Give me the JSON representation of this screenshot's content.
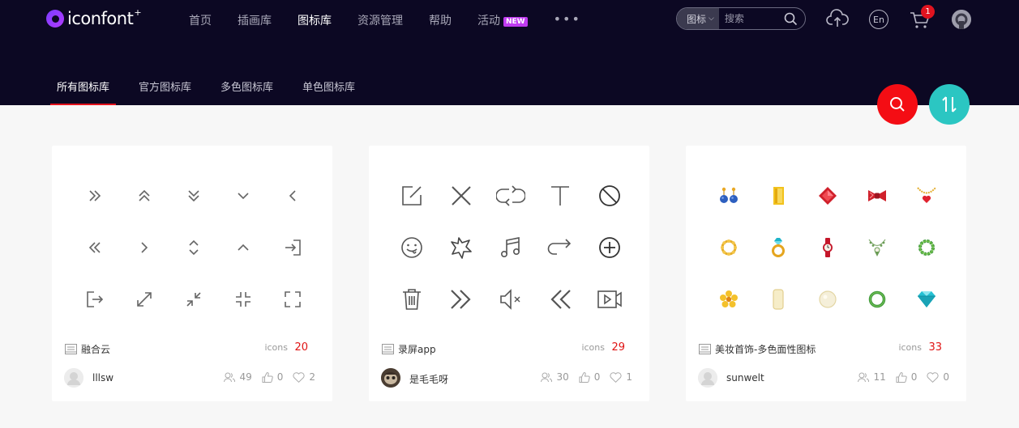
{
  "header": {
    "logo_text": "iconfont",
    "logo_plus": "+",
    "nav": [
      {
        "label": "首页",
        "active": false
      },
      {
        "label": "插画库",
        "active": false
      },
      {
        "label": "图标库",
        "active": true
      },
      {
        "label": "资源管理",
        "active": false
      },
      {
        "label": "帮助",
        "active": false
      },
      {
        "label": "活动",
        "active": false,
        "badge": "NEW"
      }
    ],
    "more_label": "•••",
    "search": {
      "type_label": "图标",
      "placeholder": "搜索"
    },
    "lang_label": "En",
    "cart_count": "1"
  },
  "tabs": [
    {
      "label": "所有图标库",
      "active": true
    },
    {
      "label": "官方图标库",
      "active": false
    },
    {
      "label": "多色图标库",
      "active": false
    },
    {
      "label": "单色图标库",
      "active": false
    }
  ],
  "cards": [
    {
      "name": "融合云",
      "count_label": "icons",
      "count": "20",
      "author": "lllsw",
      "stats": {
        "followers": "49",
        "likes": "0",
        "favorites": "2"
      },
      "icons": [
        "chevrons-right-icon",
        "chevrons-up-icon",
        "chevrons-down-icon",
        "chevron-down-icon",
        "chevron-left-icon",
        "chevrons-left-icon",
        "chevron-right-icon",
        "chevron-up-down-icon",
        "chevron-up-icon",
        "login-icon",
        "logout-icon",
        "expand-icon",
        "shrink-icon",
        "compress-icon",
        "fullscreen-icon"
      ]
    },
    {
      "name": "录屏app",
      "count_label": "icons",
      "count": "29",
      "author": "是毛毛呀",
      "stats": {
        "followers": "30",
        "likes": "0",
        "favorites": "1"
      },
      "icons": [
        "edit-icon",
        "close-icon",
        "repeat-icon",
        "text-icon",
        "forbidden-icon",
        "sticker-icon",
        "star-burst-icon",
        "music-icon",
        "redo-icon",
        "plus-circle-icon",
        "trash-icon",
        "fast-forward-icon",
        "mute-icon",
        "rewind-icon",
        "video-icon"
      ]
    },
    {
      "name": "美妆首饰-多色面性图标",
      "count_label": "icons",
      "count": "33",
      "author": "sunwelt",
      "stats": {
        "followers": "11",
        "likes": "0",
        "favorites": "0"
      },
      "icons": [
        "earrings-icon",
        "gold-bar-icon",
        "ruby-icon",
        "bow-tie-icon",
        "heart-necklace-icon",
        "gold-ring-icon",
        "diamond-ring-icon",
        "watch-icon",
        "pearl-necklace-icon",
        "green-bracelet-icon",
        "flower-brooch-icon",
        "cream-bar-icon",
        "pearl-icon",
        "green-ring-icon",
        "diamond-icon"
      ]
    }
  ],
  "colors": {
    "header_bg": "#0c0823",
    "accent_red": "#e4111c",
    "fab_teal": "#2bc6c2",
    "count_red": "#e01313"
  }
}
